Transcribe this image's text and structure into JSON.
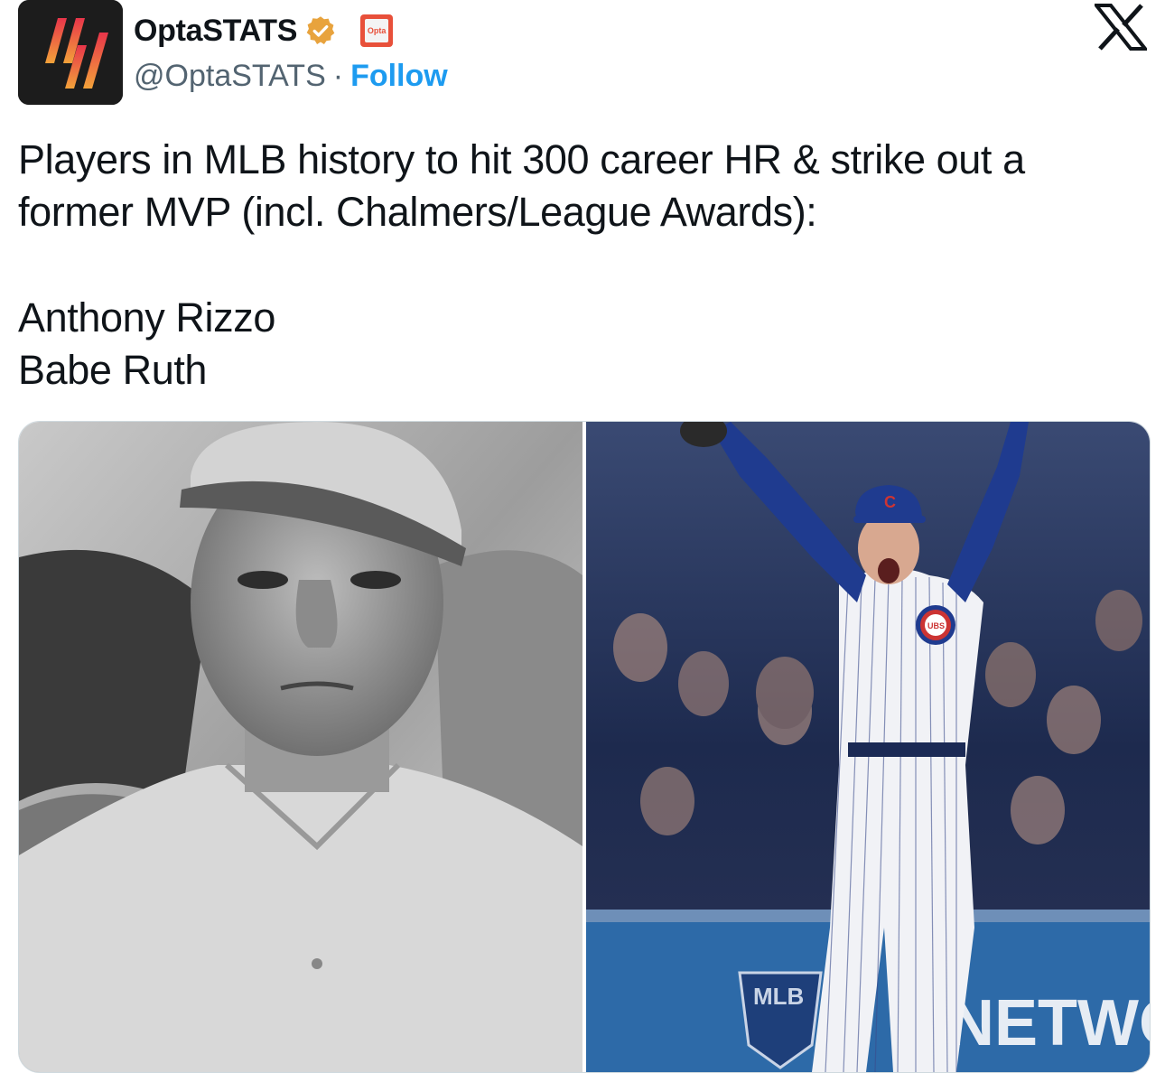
{
  "author": {
    "display_name": "OptaSTATS",
    "handle": "@OptaSTATS",
    "separator": "·",
    "follow_label": "Follow",
    "verified_icon": "verified-gold-badge-icon",
    "affiliate_badge_text": "Opta"
  },
  "tweet": {
    "text_line_1": "Players in MLB history to hit 300 career HR & strike out a",
    "text_line_2": "former MVP (incl. Chalmers/League Awards):",
    "players": [
      "Anthony Rizzo",
      "Babe Ruth"
    ]
  },
  "media": {
    "photos": [
      {
        "subject": "Babe Ruth black-and-white portrait"
      },
      {
        "subject": "Anthony Rizzo celebrating in Cubs uniform",
        "visible_text": [
          "C",
          "UBS",
          "NETWO",
          "MLB"
        ]
      }
    ]
  },
  "colors": {
    "follow": "#1d9bf0",
    "verified": "#e8a33d",
    "cubs_blue": "#1f3b8f",
    "cubs_red": "#cc3433"
  }
}
